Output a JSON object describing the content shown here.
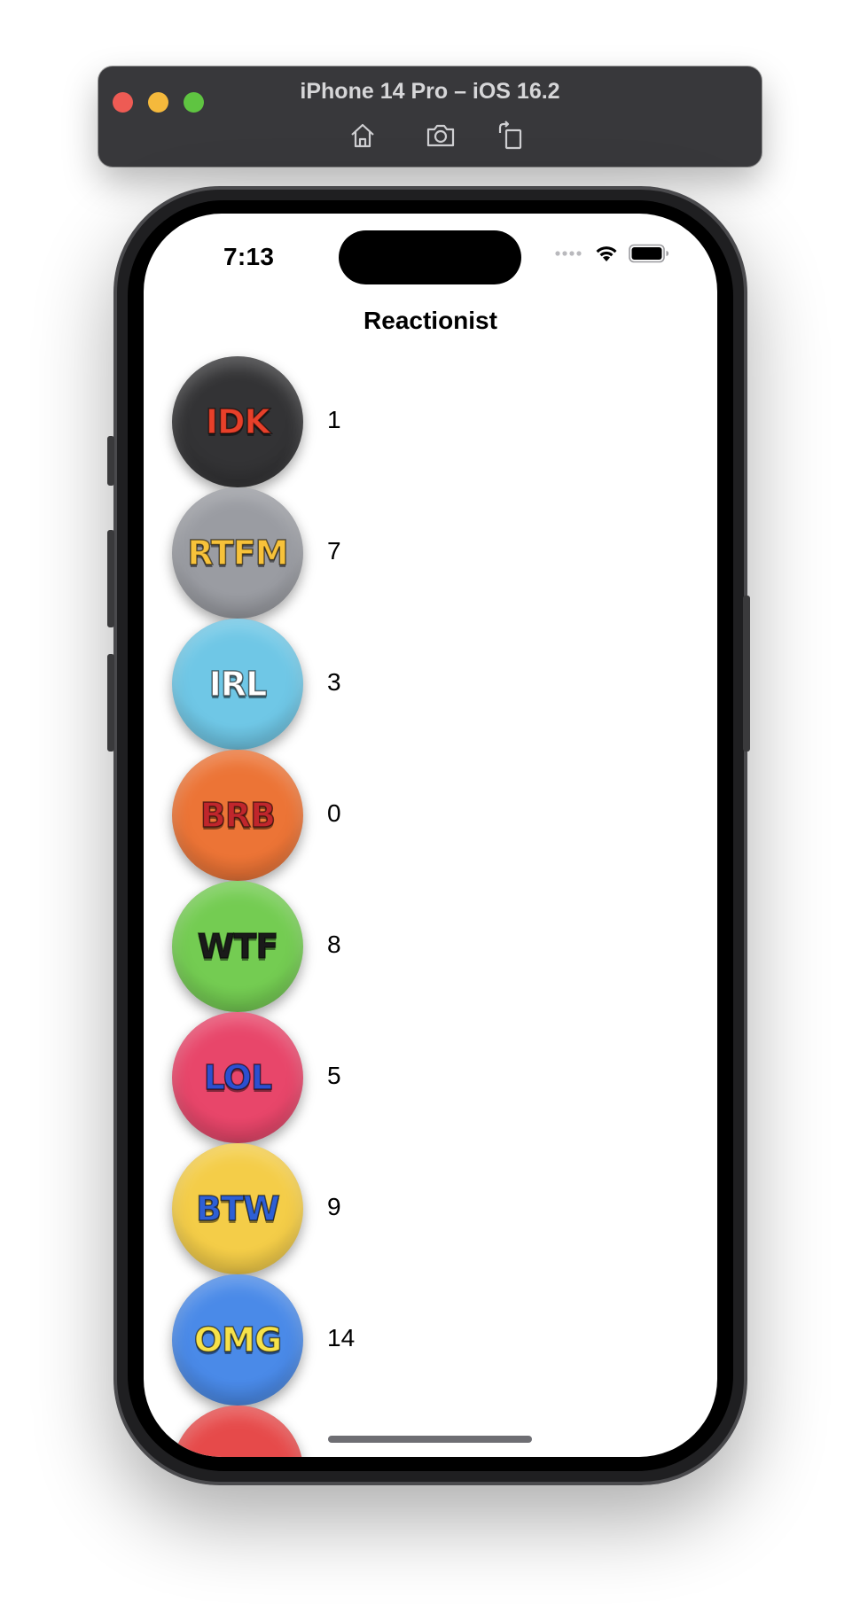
{
  "simulator": {
    "title": "iPhone 14 Pro – iOS 16.2",
    "toolbar_icons": [
      "home-icon",
      "screenshot-icon",
      "rotate-icon"
    ]
  },
  "status_bar": {
    "time": "7:13"
  },
  "navigation": {
    "title": "Reactionist"
  },
  "reactions": [
    {
      "label": "IDK",
      "count": "1",
      "bg": "#333335",
      "text_color": "#e8402a"
    },
    {
      "label": "RTFM",
      "count": "7",
      "bg": "#9a9ca2",
      "text_color": "#f7c23a"
    },
    {
      "label": "IRL",
      "count": "3",
      "bg": "#6fc7e6",
      "text_color": "#ffffff"
    },
    {
      "label": "BRB",
      "count": "0",
      "bg": "#ec7436",
      "text_color": "#c0262c"
    },
    {
      "label": "WTF",
      "count": "8",
      "bg": "#74cc52",
      "text_color": "#1a1a1a"
    },
    {
      "label": "LOL",
      "count": "5",
      "bg": "#e8466a",
      "text_color": "#2d4fd0"
    },
    {
      "label": "BTW",
      "count": "9",
      "bg": "#f4cd48",
      "text_color": "#2e5fd4"
    },
    {
      "label": "OMG",
      "count": "14",
      "bg": "#4a8ae8",
      "text_color": "#f6e24a"
    },
    {
      "label": "",
      "count": "",
      "bg": "#e64a4a",
      "text_color": "#ffffff"
    }
  ]
}
